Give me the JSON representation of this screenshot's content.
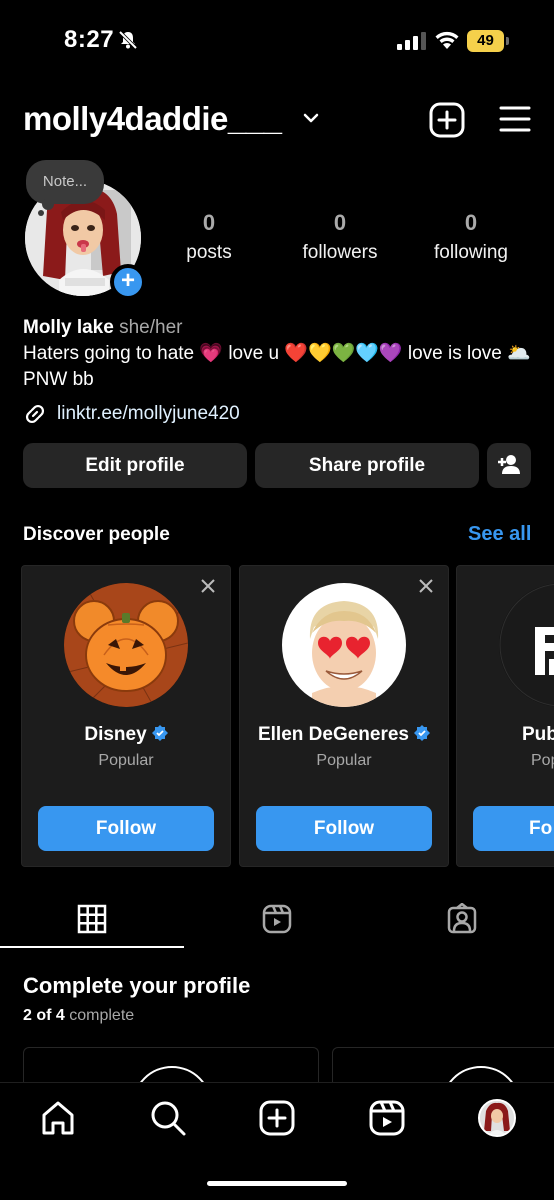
{
  "status_bar": {
    "time": "8:27",
    "battery": "49"
  },
  "header": {
    "username": "molly4daddie___"
  },
  "note": {
    "placeholder": "Note..."
  },
  "stats": [
    {
      "value": "0",
      "label": "posts"
    },
    {
      "value": "0",
      "label": "followers"
    },
    {
      "value": "0",
      "label": "following"
    }
  ],
  "bio": {
    "name": "Molly lake",
    "pronouns": "she/her",
    "line1": "Haters going to hate 💗 love u ❤️💛💚🩵💜 love is love 🌥️PNW bb",
    "link": "linktr.ee/mollyjune420"
  },
  "buttons": {
    "edit_profile": "Edit profile",
    "share_profile": "Share profile"
  },
  "discover": {
    "title": "Discover people",
    "see_all": "See all",
    "cards": [
      {
        "name": "Disney",
        "subtitle": "Popular",
        "follow": "Follow"
      },
      {
        "name": "Ellen DeGeneres",
        "subtitle": "Popular",
        "follow": "Follow"
      },
      {
        "name": "Pub",
        "subtitle": "Pop",
        "follow": "Fo"
      }
    ]
  },
  "complete_profile": {
    "title": "Complete your profile",
    "count": "2 of 4",
    "suffix": "complete"
  },
  "colors": {
    "accent": "#3897f0",
    "battery": "#f5d04b",
    "card_bg": "#1c1c1c",
    "button_bg": "#262626"
  }
}
